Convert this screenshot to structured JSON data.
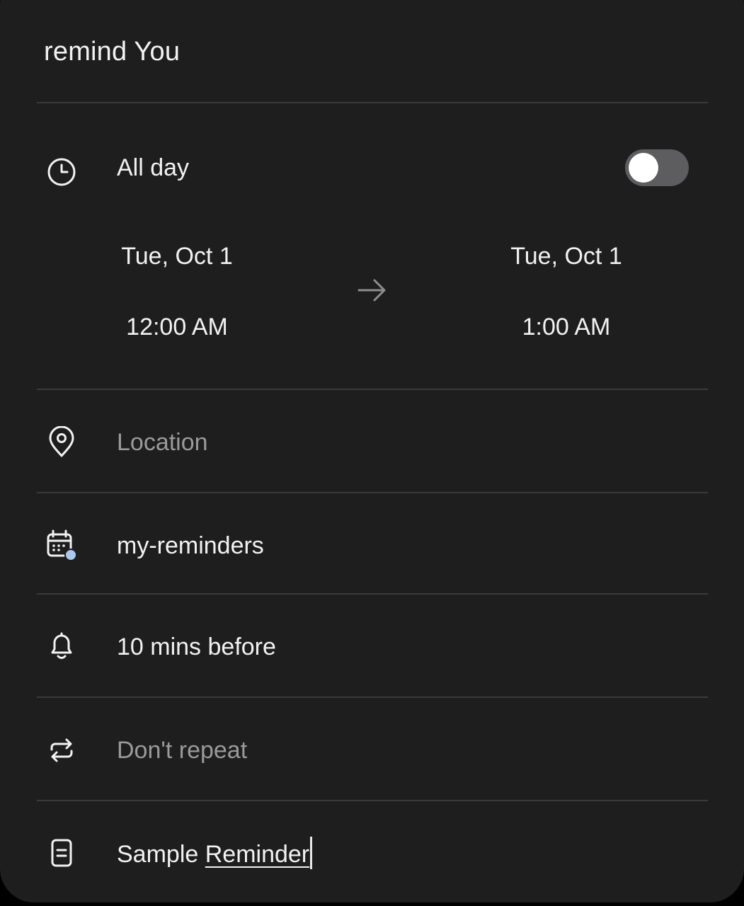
{
  "header": {
    "title": "remind You"
  },
  "all_day": {
    "label": "All day",
    "icon": "clock-icon",
    "enabled": false
  },
  "start": {
    "date": "Tue, Oct 1",
    "time": "12:00 AM"
  },
  "end": {
    "date": "Tue, Oct 1",
    "time": "1:00 AM"
  },
  "location": {
    "placeholder": "Location",
    "icon": "location-pin-icon"
  },
  "calendar": {
    "name": "my-reminders",
    "icon": "calendar-icon",
    "color": "#a8c8f0"
  },
  "notification": {
    "label": "10 mins before",
    "icon": "bell-icon"
  },
  "repeat": {
    "label": "Don't repeat",
    "icon": "repeat-icon"
  },
  "note": {
    "word1": "Sample",
    "word2": "Reminder",
    "icon": "note-icon"
  },
  "colors": {
    "background": "#1e1e1f",
    "text": "#f2f2f2",
    "placeholder": "#9a9a9b",
    "divider": "#3b3b3c",
    "toggle_track": "#5d5d60"
  }
}
